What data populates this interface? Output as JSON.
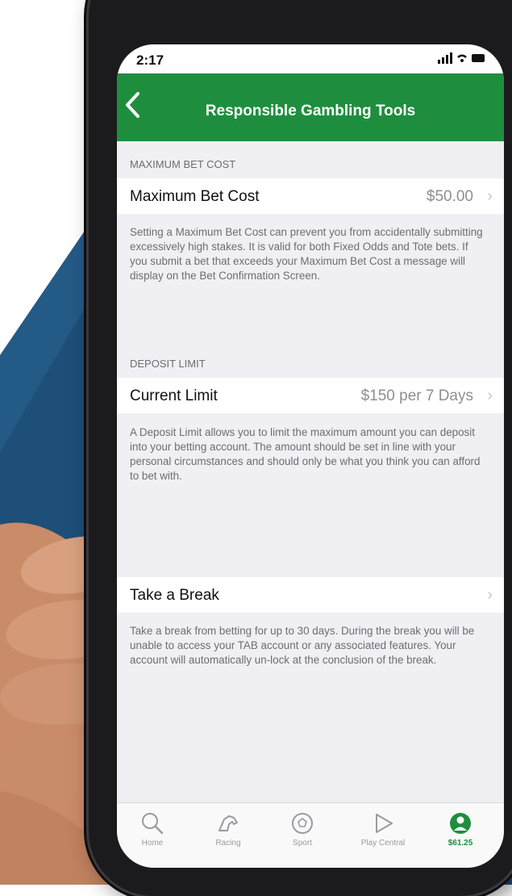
{
  "status_bar": {
    "time": "2:17",
    "icons": "signal-wifi-battery"
  },
  "nav": {
    "back_icon": "chevron-left-icon",
    "title": "Responsible Gambling Tools"
  },
  "max_bet": {
    "section_header": "MAXIMUM BET COST",
    "label": "Maximum Bet Cost",
    "value": "$50.00",
    "note": "Setting a Maximum Bet Cost can prevent you from accidentally submitting excessively high stakes. It is valid for both Fixed Odds and Tote bets. If you submit a bet that exceeds your Maximum Bet Cost a message will display on the Bet Confirmation Screen."
  },
  "deposit": {
    "section_header": "DEPOSIT LIMIT",
    "label": "Current Limit",
    "value": "$150 per 7 Days",
    "note": "A Deposit Limit allows you to limit the maximum amount you can deposit into your betting account. The amount should be set in line with your personal circumstances and should only be what you think you can afford to bet with."
  },
  "break": {
    "label": "Take a Break",
    "note": "Take a break from betting for up to 30 days. During the break you will be unable to access your TAB account or any associated features. Your account will automatically un-lock at the conclusion of the break."
  },
  "tabbar": {
    "items": [
      {
        "label": "Home",
        "icon": "search-icon"
      },
      {
        "label": "Racing",
        "icon": "horse-icon"
      },
      {
        "label": "Sport",
        "icon": "ball-icon"
      },
      {
        "label": "Play Central",
        "icon": "play-icon"
      },
      {
        "label": "$61.25",
        "icon": "account-icon"
      }
    ]
  },
  "colors": {
    "accent": "#1e8e3e",
    "background_blue": "#1d4f78"
  }
}
